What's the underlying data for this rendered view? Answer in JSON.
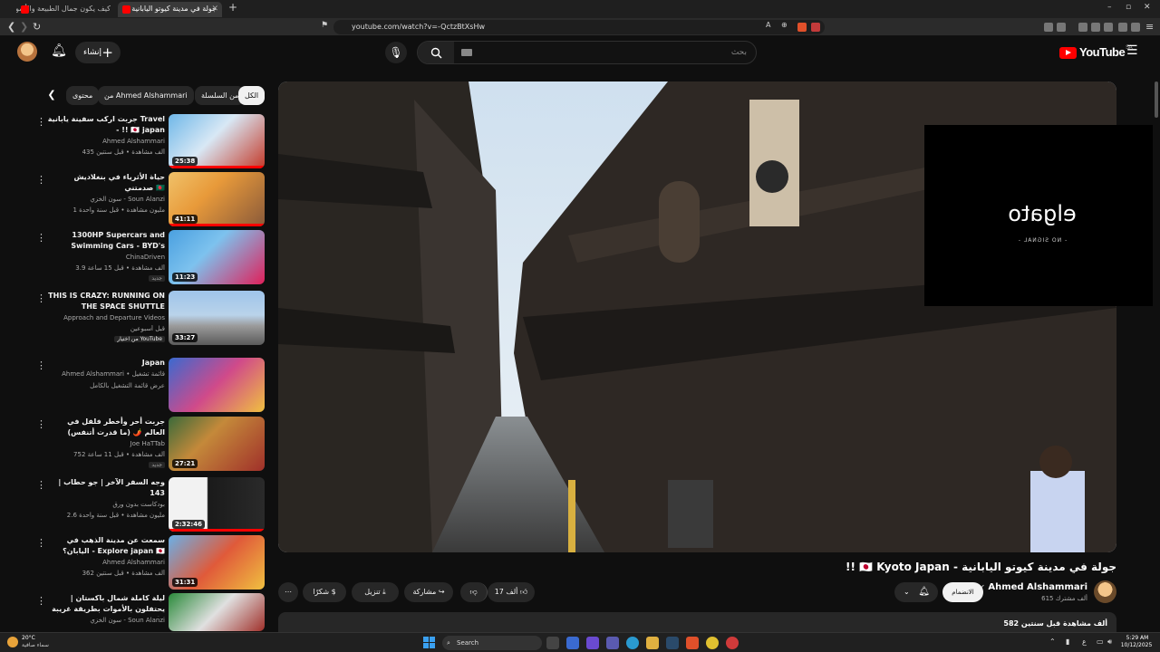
{
  "browser": {
    "tabs": [
      {
        "title": "كيف يكون جمال الطبيعة والأسواق الشع...",
        "active": false
      },
      {
        "title": "جولة في مدينة كيوتو اليابانية",
        "active": true
      }
    ],
    "new_tab": "+",
    "url": "youtube.com/watch?v=-QctzBtXsHw",
    "window": {
      "minimize": "–",
      "maximize": "▫",
      "close": "✕"
    }
  },
  "header": {
    "create_label": "إنشاء",
    "search_placeholder": "بحث",
    "logo_text": "YouTube",
    "region": "SA"
  },
  "chips": [
    {
      "label": "الكل",
      "active": true
    },
    {
      "label": "من السلسلة",
      "active": false
    },
    {
      "label": "من Ahmed Alshammari",
      "active": false
    },
    {
      "label": "محتوى",
      "active": false
    }
  ],
  "recommendations": [
    {
      "title": "جربت اركب سفينة يابانية Travel - !! 🇯🇵 japan",
      "channel": "Ahmed Alshammari",
      "meta": "435 ألف مشاهدة • قبل سنتين",
      "duration": "25:38",
      "badge": "",
      "progress": 1.0
    },
    {
      "title": "حياة الأثرياء في بنغلاديش صدمتني 🇧🇩",
      "channel": "سون الخزي - Soun Alanzi",
      "meta": "1 مليون مشاهدة • قبل سنة واحدة",
      "duration": "41:11",
      "badge": "",
      "progress": 1.0
    },
    {
      "title": "1300HP Supercars and Swimming Cars - BYD's Mind-...",
      "channel": "ChinaDriven",
      "meta": "3.9 ألف مشاهدة • قبل 15 ساعة",
      "duration": "11:23",
      "badge": "جديد",
      "progress": 0
    },
    {
      "title": "THIS IS CRAZY: RUNNING ON THE SPACE SHUTTLE RUNWAY",
      "channel": "Approach and Departure Videos",
      "meta": "قبل أسبوعين",
      "duration": "33:27",
      "badge": "من اختيار YouTube",
      "progress": 0
    },
    {
      "title": "Japan",
      "channel": "Ahmed Alshammari • قائمة تشغيل",
      "meta": "عرض قائمة التشغيل بالكامل",
      "duration": "",
      "badge": "",
      "progress": 0
    },
    {
      "title": "جربت أحر وأخطر فلفل في العالم 🌶️ (ما قدرت أتنفس)",
      "channel": "Joe HaTTab",
      "meta": "752 ألف مشاهدة • قبل 11 ساعة",
      "duration": "27:21",
      "badge": "جديد",
      "progress": 0
    },
    {
      "title": "وجه السفر الآخر | جو حطاب | 143",
      "channel": "بودكاست بدون ورق",
      "meta": "2.6 مليون مشاهدة • قبل سنة واحدة",
      "duration": "2:32:46",
      "badge": "",
      "progress": 1.0
    },
    {
      "title": "سمعت عن مدينة الذهب في اليابان؟ - Explore japan 🇯🇵",
      "channel": "Ahmed Alshammari",
      "meta": "362 ألف مشاهدة • قبل سنتين",
      "duration": "31:31",
      "badge": "",
      "progress": 0
    },
    {
      "title": "ليلة كاملة شمال باكستان | يحتفلون بالأموات بطريقة غريبة 🇵🇰",
      "channel": "سون الخزي - Soun Alanzi",
      "meta": "",
      "duration": "",
      "badge": "",
      "progress": 0
    }
  ],
  "overlay": {
    "brand": "elgato",
    "status": "- NO SIGNAL -"
  },
  "video": {
    "title": "جولة في مدينة كيوتو اليابانية - 🇯🇵 Kyoto Japan !!",
    "channel": "Ahmed Alshammari",
    "subscribers": "615 ألف مشترك",
    "join_label": "الانضمام",
    "likes": "17 ألف",
    "share_label": "مشاركة",
    "download_label": "تنزيل",
    "thanks_label": "شكرًا",
    "views_date": "582 ألف مشاهدة  قبل سنتين"
  },
  "taskbar": {
    "temp": "20°C",
    "weather": "سماء صافية",
    "search_label": "Search",
    "time": "5:29 AM",
    "date": "10/12/2025",
    "lang": "ع"
  },
  "colors": {
    "accent": "#ff0000",
    "background": "#0f0f0f",
    "chip": "#272727"
  }
}
